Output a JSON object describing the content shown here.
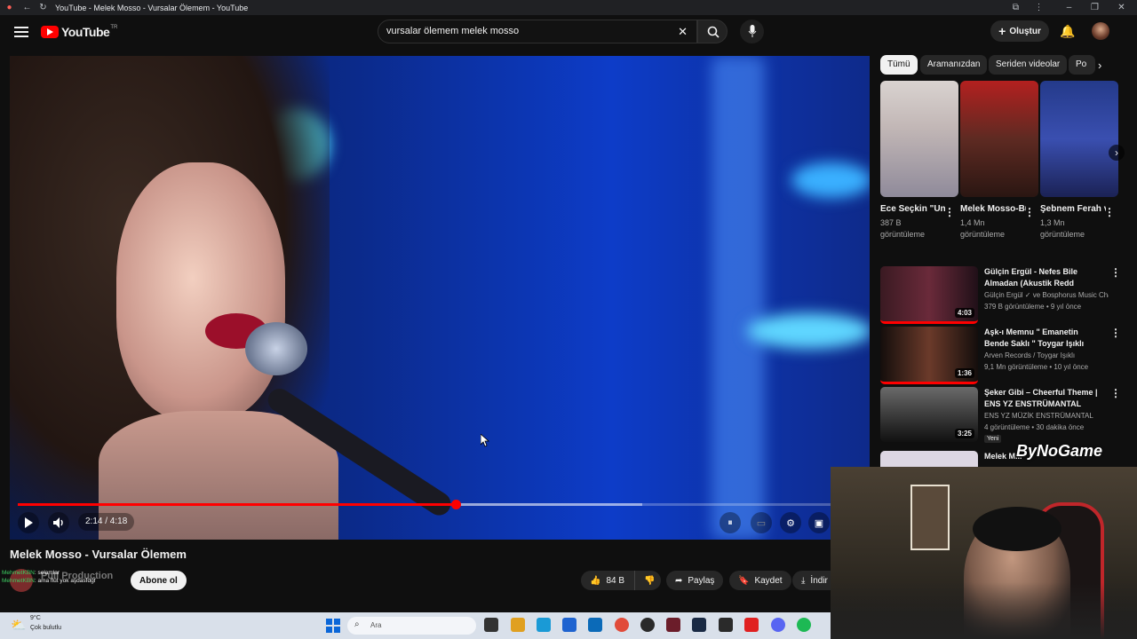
{
  "browser": {
    "tab_title": "YouTube - Melek Mosso - Vursalar Ölemem - YouTube"
  },
  "header": {
    "logo_text": "YouTube",
    "region": "TR",
    "search_value": "vursalar ölemem melek mosso",
    "create_label": "Oluştur"
  },
  "player": {
    "current_time": "2:14",
    "duration": "4:18",
    "time_text": "2:14 / 4:18",
    "progress_fraction": 0.519,
    "buffered_fraction": 0.74
  },
  "video": {
    "title": "Melek Mosso - Vursalar Ölemem",
    "channel": "Pull Production",
    "subscribe_label": "Abone ol",
    "likes": "84 B",
    "share_label": "Paylaş",
    "save_label": "Kaydet",
    "download_label": "İndir"
  },
  "chat_overlay": [
    {
      "user": "MehmetKBN",
      "text": ": selamlar"
    },
    {
      "user": "MehmetKBN",
      "text": ": ama flüt yok aşdasfdgf"
    }
  ],
  "chips": [
    "Tümü",
    "Aramanızdan",
    "Seriden videolar",
    "Po"
  ],
  "shorts": [
    {
      "title": "Ece Seçkin \"Unutursun ...",
      "views": "387 B",
      "views_label": "görüntüleme"
    },
    {
      "title": "Melek Mosso-Bu ...",
      "views": "1,4 Mn",
      "views_label": "görüntüleme"
    },
    {
      "title": "Şebnem Ferah ve ...",
      "views": "1,3 Mn",
      "views_label": "görüntüleme"
    }
  ],
  "recommendations": [
    {
      "title": "Gülçin Ergül - Nefes Bile Almadan (Akustik Redd Cover)...",
      "channel": "Gülçin Ergül ✓ ve Bosphorus Music Cha...",
      "meta": "379 B görüntüleme • 9 yıl önce",
      "duration": "4:03",
      "badge": ""
    },
    {
      "title": "Aşk-ı Memnu \" Emanetin Bende Saklı \" Toygar Işıklı",
      "channel": "Arven Records / Toygar Işıklı",
      "meta": "9,1 Mn görüntüleme • 10 yıl önce",
      "duration": "1:36",
      "badge": ""
    },
    {
      "title": "Şeker Gibi – Cheerful Theme | ENS YZ ENSTRÜMANTAL",
      "channel": "ENS YZ MÜZİK ENSTRÜMANTAL",
      "meta": "4 görüntüleme • 30 dakika önce",
      "duration": "3:25",
      "badge": "Yeni"
    },
    {
      "title": "Melek M...",
      "channel": "",
      "meta": "",
      "duration": "",
      "badge": ""
    }
  ],
  "overlay_watermark": "ByNoGame",
  "taskbar": {
    "weather_temp": "9°C",
    "weather_text": "Çok bulutlu",
    "search_placeholder": "Ara"
  },
  "colors": {
    "accent": "#ff0000",
    "background": "#0f0f0f",
    "chip_active": "#f1f1f1"
  }
}
